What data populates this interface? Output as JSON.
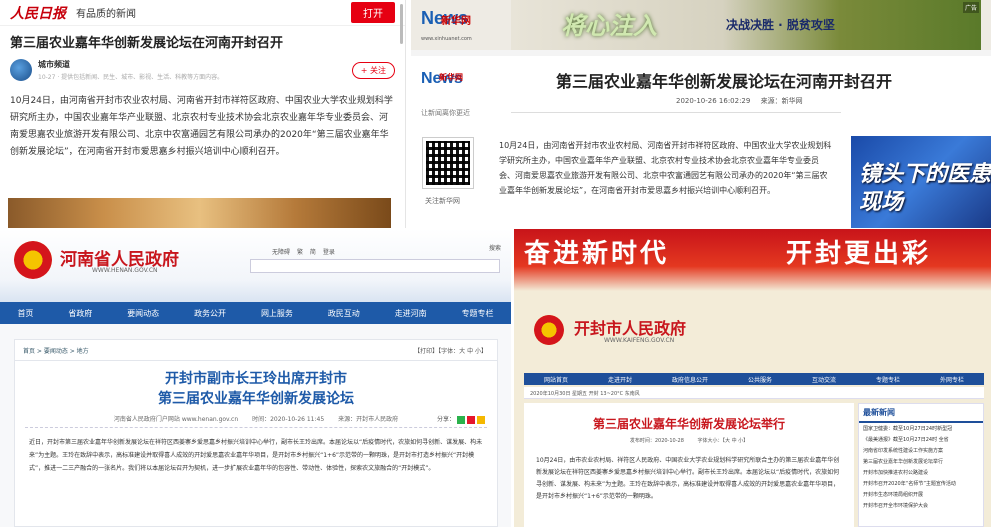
{
  "panel_a": {
    "logo": "人民日报",
    "slogan": "有品质的新闻",
    "open_button": "打开",
    "title": "第三届农业嘉年华创新发展论坛在河南开封召开",
    "author_name": "城市频道",
    "author_meta": "10-27 · 提供包括新闻、民生、城市、影视、生活、科教等方面内容。",
    "follow_button": "+ 关注",
    "body": "10月24日，由河南省开封市农业农村局、河南省开封市祥符区政府、中国农业大学农业规划科学研究所主办，中国农业嘉年华产业联盟、北京农村专业技术协会北京农业嘉年华专业委员会、河南爱思嘉农业旅游开发有限公司、北京中农富通园艺有限公司承办的2020年“第三届农业嘉年华创新发展论坛”，在河南省开封市爱思嘉乡村振兴培训中心顺利召开。"
  },
  "panel_b": {
    "logo_letters": "News",
    "logo_cn": "新华网",
    "logo_url": "www.xinhuanet.com",
    "ad_calligraphy": "将心注入",
    "ad_slogan": "决战决胜 · 脱贫攻坚",
    "ad_tag": "广告",
    "slogan": "让新闻离你更近",
    "title": "第三届农业嘉年华创新发展论坛在河南开封召开",
    "date": "2020-10-26 16:02:29",
    "source": "来源：新华网",
    "qr_label": "关注新华网",
    "body": "10月24日，由河南省开封市农业农村局、河南省开封市祥符区政府、中国农业大学农业规划科学研究所主办，中国农业嘉年华产业联盟、北京农村专业技术协会北京农业嘉年华专业委员会、河南爱思嘉农业旅游开发有限公司、北京中农富通园艺有限公司承办的2020年“第三届农业嘉年华创新发展论坛”，在河南省开封市爱思嘉乡村振兴培训中心顺利召开。",
    "side_image_text": "镜头下的医患现场"
  },
  "panel_c": {
    "site_title": "河南省人民政府",
    "site_url": "WWW.HENAN.GOV.CN",
    "header_links": [
      "无障碍",
      "繁",
      "简",
      "登录"
    ],
    "search_label": "搜索",
    "nav": [
      "首页",
      "省政府",
      "要闻动态",
      "政务公开",
      "网上服务",
      "政民互动",
      "走进河南",
      "专题专栏"
    ],
    "breadcrumb": "首页 > 要闻动态 > 地方",
    "tools": "【打印】【字体：大 中 小】",
    "title_line1": "开封市副市长王玲出席开封市",
    "title_line2": "第三届农业嘉年华创新发展论坛",
    "meta": [
      "河南省人民政府门户网站 www.henan.gov.cn",
      "时间：2020-10-26 11:45",
      "来源：开封市人民政府"
    ],
    "share_label": "分享：",
    "body": "近日，开封市第三届农业嘉年华创新发展论坛在祥符区西姜寨乡爱思嘉乡村振兴培训中心举行，副市长王玲出席。本届论坛以“后疫情时代，农旅如何寻创新、谋发展、构未来”为主题。王玲在致辞中表示，高标准建设并取得喜人成效的开封爱思嘉农业嘉年华项目，是开封市乡村振兴“1+6”示范带的一颗明珠，是开封市打造乡村振兴“开封模式”，推进一二三产融合的一张名片。我们将以本届论坛召开为契机，进一步扩展农业嘉年华的包容性、带动性、体验性，探索农文旅融合的“开封模式”。"
  },
  "panel_d": {
    "banner_left": "奋进新时代",
    "banner_right": "开封更出彩",
    "site_title": "开封市人民政府",
    "site_url": "WWW.KAIFENG.GOV.CN",
    "nav": [
      "网站首页",
      "走进开封",
      "政府信息公开",
      "公共服务",
      "互动交流",
      "专题专栏",
      "外网专栏"
    ],
    "subbar": "2020年10月30日 星期五   开封 13~20°C  东南风",
    "title": "第三届农业嘉年华创新发展论坛举行",
    "meta": [
      "发布时间：2020-10-28",
      "字体大小：【大 中 小】"
    ],
    "body": "10月24日，由市农业农村局、祥符区人民政府、中国农业大学农业规划科学研究所联合主办的第三届农业嘉年华创新发展论坛在祥符区西姜寨乡爱思嘉乡村振兴培训中心举行。副市长王玲出席。本届论坛以“后疫情时代，农旅如何寻创新、谋发展、构未来”为主题。王玲在致辞中表示，高标准建设并取得喜人成效的开封爱思嘉农业嘉年华项目，是开封市乡村振兴“1+6”示范带的一颗明珠。",
    "sidebar_title": "最新新闻",
    "sidebar_items": [
      "国家卫健委：截至10月27日24时新型冠",
      "《最美通报》截至10月27日24时 全省",
      "河南省印发系统性建设工作实施方案",
      "第三届农业嘉年华创新发展论坛举行",
      "开封市加快推进农村公路建设",
      "开封市召开2020年“名师节”主题宣传活动",
      "开封市生态环境局组织开展",
      "开封市召开全市环境保护大会"
    ]
  }
}
